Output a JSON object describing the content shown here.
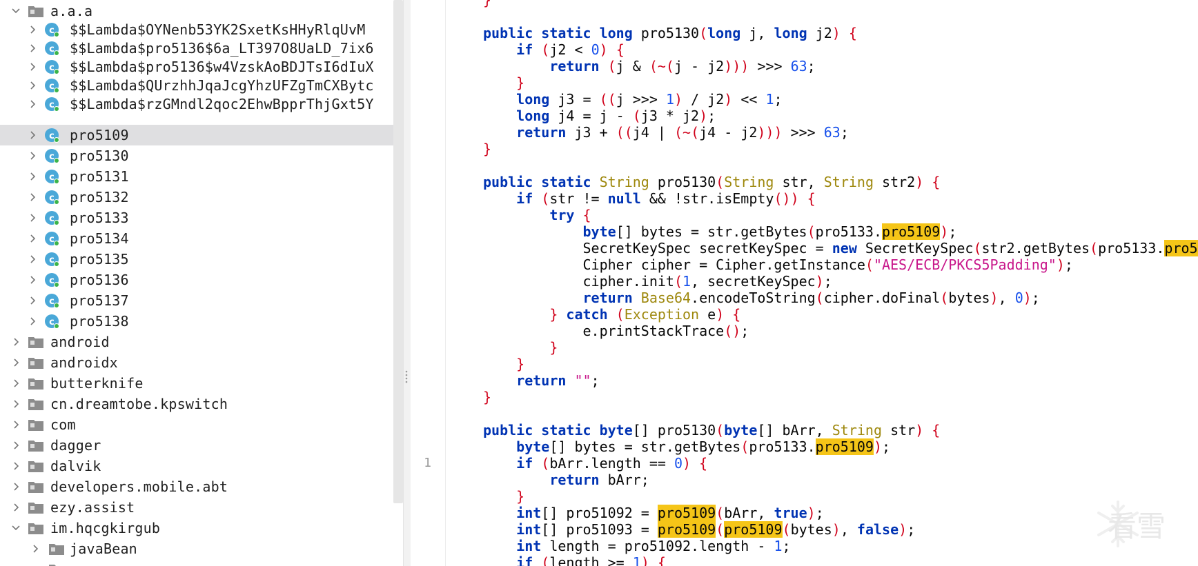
{
  "tree": {
    "root_package": "a.a.a",
    "lambda_classes": [
      "$$Lambda$OYNenb53YK2SxetKsHHyRlqUvM",
      "$$Lambda$pro5136$6a_LT397O8UaLD_7ix6",
      "$$Lambda$pro5136$w4VzskAoBDJTsI6dIuX",
      "$$Lambda$QUrzhhJqaJcgYhzUFZgTmCXBytc",
      "$$Lambda$rzGMndl2qoc2EhwBpprThjGxt5Y"
    ],
    "classes": [
      "pro5109",
      "pro5130",
      "pro5131",
      "pro5132",
      "pro5133",
      "pro5134",
      "pro5135",
      "pro5136",
      "pro5137",
      "pro5138"
    ],
    "selected_class": "pro5109",
    "packages": [
      "android",
      "androidx",
      "butterknife",
      "cn.dreamtobe.kpswitch",
      "com",
      "dagger",
      "dalvik",
      "developers.mobile.abt",
      "ezy.assist",
      "im.hqcgkirgub"
    ],
    "subpackage": "javaBean"
  },
  "editor": {
    "gutter_line_number": "1",
    "watermark_text": "看雪"
  },
  "colors": {
    "keyword": "#0033b3",
    "type": "#9e880d",
    "bracket": "#d0021b",
    "number": "#1750eb",
    "string": "#c8168a",
    "highlight": "#f5c518",
    "selection": "#dfdfe1"
  }
}
